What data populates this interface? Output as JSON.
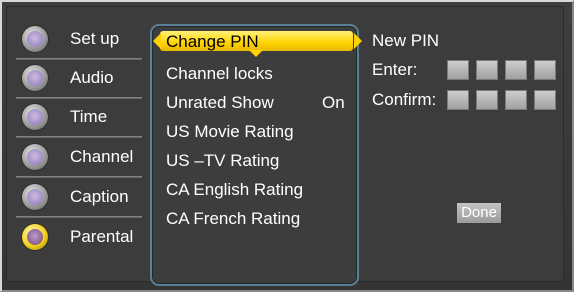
{
  "sidebar": {
    "items": [
      {
        "label": "Set up",
        "icon": "gear-icon"
      },
      {
        "label": "Audio",
        "icon": "speaker-icon"
      },
      {
        "label": "Time",
        "icon": "clock-icon"
      },
      {
        "label": "Channel",
        "icon": "channel-icon"
      },
      {
        "label": "Caption",
        "icon": "caption-icon"
      },
      {
        "label": "Parental",
        "icon": "lock-icon",
        "active": true
      }
    ]
  },
  "menu": {
    "selected": "Change PIN",
    "items": [
      {
        "label": "Channel locks"
      },
      {
        "label": "Unrated Show",
        "value": "On"
      },
      {
        "label": "US Movie Rating"
      },
      {
        "label": "US –TV Rating"
      },
      {
        "label": "CA English Rating"
      },
      {
        "label": "CA French Rating"
      }
    ]
  },
  "pin": {
    "title": "New PIN",
    "enter_label": "Enter:",
    "confirm_label": "Confirm:",
    "done_label": "Done"
  },
  "colors": {
    "highlight": "#ffd200",
    "panel_border": "#5d7f93"
  }
}
